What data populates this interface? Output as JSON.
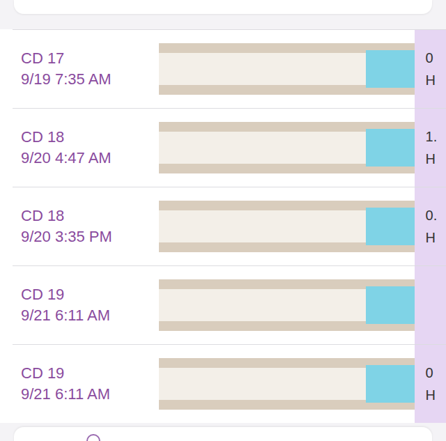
{
  "entries": [
    {
      "day": "CD 17",
      "time": "9/19 7:35 AM",
      "reading": [
        "0",
        "H"
      ]
    },
    {
      "day": "CD 18",
      "time": "9/20 4:47 AM",
      "reading": [
        "1.",
        "H"
      ]
    },
    {
      "day": "CD 18",
      "time": "9/20 3:35 PM",
      "reading": [
        "0.",
        "H"
      ]
    },
    {
      "day": "CD 19",
      "time": "9/21 6:11 AM",
      "reading": []
    },
    {
      "day": "CD 19",
      "time": "9/21 6:11 AM",
      "reading": [
        "0",
        "H"
      ]
    }
  ]
}
